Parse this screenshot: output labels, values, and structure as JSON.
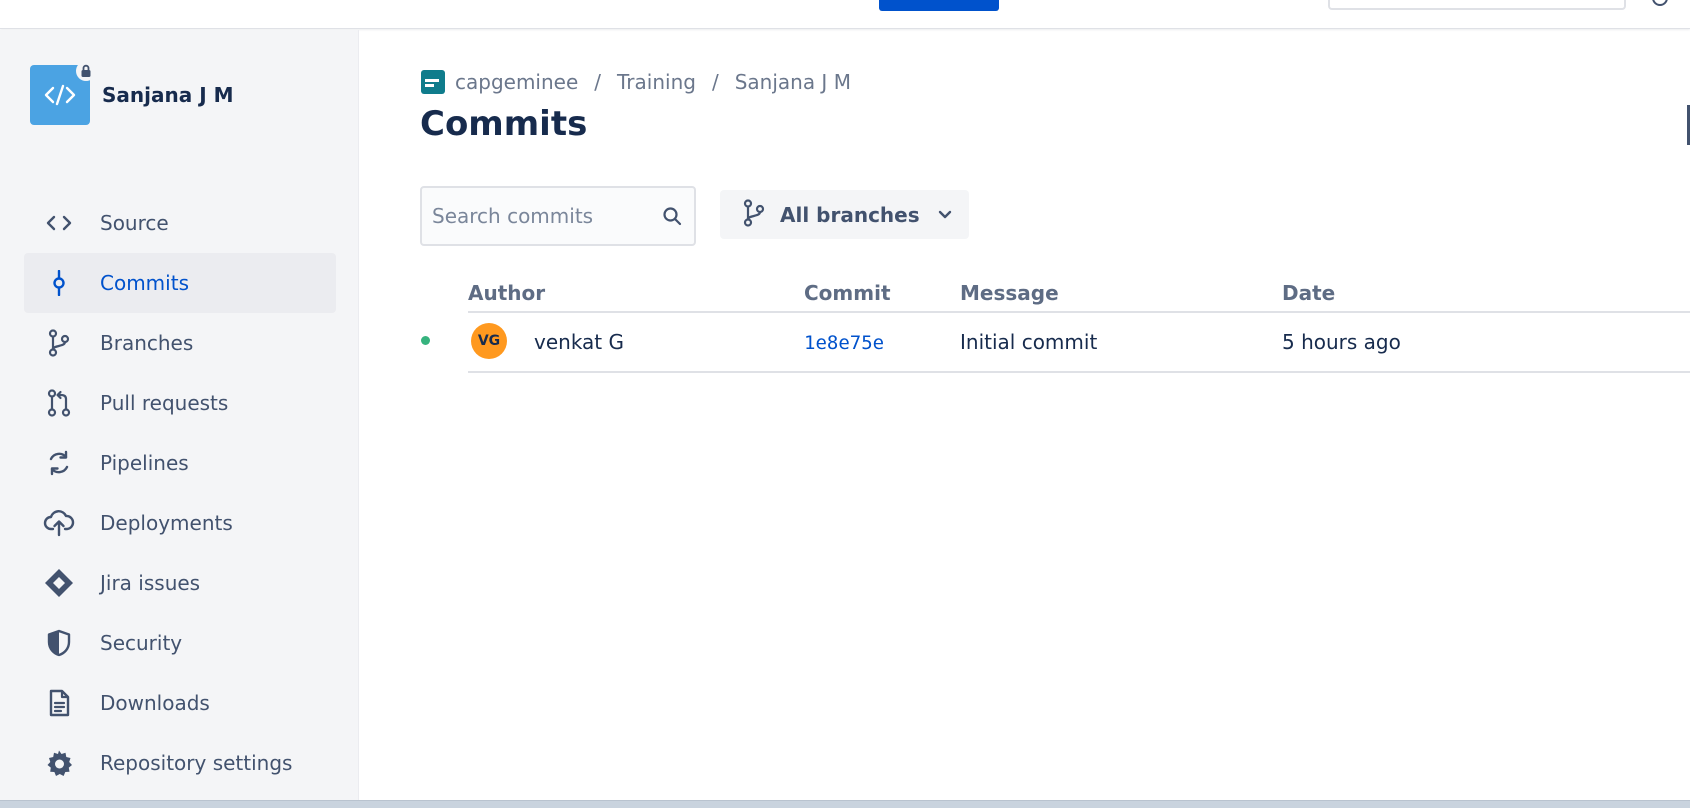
{
  "repository": {
    "name": "Sanjana J M"
  },
  "sidebar": {
    "items": [
      {
        "label": "Source",
        "icon": "code-icon"
      },
      {
        "label": "Commits",
        "icon": "commit-icon",
        "active": true
      },
      {
        "label": "Branches",
        "icon": "branch-icon"
      },
      {
        "label": "Pull requests",
        "icon": "pull-request-icon"
      },
      {
        "label": "Pipelines",
        "icon": "pipelines-icon"
      },
      {
        "label": "Deployments",
        "icon": "cloud-upload-icon"
      },
      {
        "label": "Jira issues",
        "icon": "jira-icon"
      },
      {
        "label": "Security",
        "icon": "shield-icon"
      },
      {
        "label": "Downloads",
        "icon": "document-icon"
      },
      {
        "label": "Repository settings",
        "icon": "gear-icon"
      }
    ]
  },
  "breadcrumb": {
    "workspace": "capgeminee",
    "project": "Training",
    "repo": "Sanjana J M",
    "separator": "/"
  },
  "page": {
    "title": "Commits"
  },
  "search": {
    "placeholder": "Search commits"
  },
  "branch_filter": {
    "label": "All branches"
  },
  "table": {
    "columns": [
      "Author",
      "Commit",
      "Message",
      "Date"
    ],
    "rows": [
      {
        "author_initials": "VG",
        "author": "venkat G",
        "commit": "1e8e75e",
        "message": "Initial commit",
        "date": "5 hours ago"
      }
    ]
  },
  "colors": {
    "accent": "#0052cc",
    "sidebar_bg": "#f4f5f7",
    "repo_avatar": "#4ba3e3",
    "author_avatar": "#ff991f",
    "status_ok": "#36b37e"
  }
}
